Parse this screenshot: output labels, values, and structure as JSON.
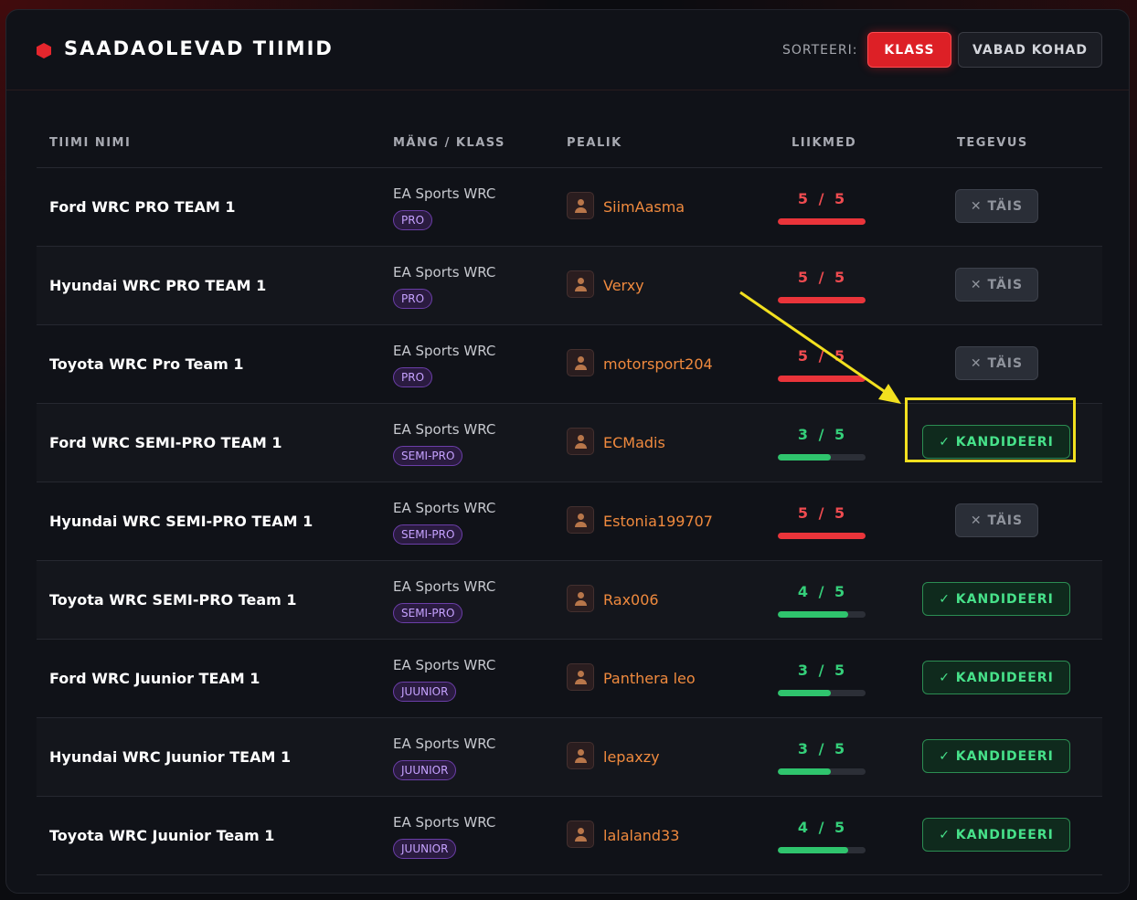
{
  "header": {
    "title": "SAADAOLEVAD TIIMID",
    "sort_label": "SORTEERI:",
    "sort_options": [
      "KLASS",
      "VABAD KOHAD"
    ]
  },
  "columns": [
    "TIIMI NIMI",
    "MÄNG / KLASS",
    "PEALIK",
    "LIIKMED",
    "TEGEVUS"
  ],
  "rows": [
    {
      "team": "Ford WRC PRO TEAM 1",
      "game": "EA Sports WRC",
      "class": "PRO",
      "leader": "SiimAasma",
      "members": "5 / 5",
      "fill": 1.0,
      "full": true,
      "action": "✕ TÄIS"
    },
    {
      "team": "Hyundai WRC PRO TEAM 1",
      "game": "EA Sports WRC",
      "class": "PRO",
      "leader": "Verxy",
      "members": "5 / 5",
      "fill": 1.0,
      "full": true,
      "action": "✕ TÄIS"
    },
    {
      "team": "Toyota WRC Pro Team 1",
      "game": "EA Sports WRC",
      "class": "PRO",
      "leader": "motorsport204",
      "members": "5 / 5",
      "fill": 1.0,
      "full": true,
      "action": "✕ TÄIS"
    },
    {
      "team": "Ford WRC SEMI-PRO TEAM 1",
      "game": "EA Sports WRC",
      "class": "SEMI-PRO",
      "leader": "ECMadis",
      "members": "3 / 5",
      "fill": 0.6,
      "full": false,
      "action": "✓ KANDIDEERI"
    },
    {
      "team": "Hyundai WRC SEMI-PRO TEAM 1",
      "game": "EA Sports WRC",
      "class": "SEMI-PRO",
      "leader": "Estonia199707",
      "members": "5 / 5",
      "fill": 1.0,
      "full": true,
      "action": "✕ TÄIS"
    },
    {
      "team": "Toyota WRC SEMI-PRO Team 1",
      "game": "EA Sports WRC",
      "class": "SEMI-PRO",
      "leader": "Rax006",
      "members": "4 / 5",
      "fill": 0.8,
      "full": false,
      "action": "✓ KANDIDEERI"
    },
    {
      "team": "Ford WRC Juunior TEAM 1",
      "game": "EA Sports WRC",
      "class": "JUUNIOR",
      "leader": "Panthera leo",
      "members": "3 / 5",
      "fill": 0.6,
      "full": false,
      "action": "✓ KANDIDEERI"
    },
    {
      "team": "Hyundai WRC Juunior TEAM 1",
      "game": "EA Sports WRC",
      "class": "JUUNIOR",
      "leader": "lepaxzy",
      "members": "3 / 5",
      "fill": 0.6,
      "full": false,
      "action": "✓ KANDIDEERI"
    },
    {
      "team": "Toyota WRC Juunior Team 1",
      "game": "EA Sports WRC",
      "class": "JUUNIOR",
      "leader": "lalaland33",
      "members": "4 / 5",
      "fill": 0.8,
      "full": false,
      "action": "✓ KANDIDEERI"
    }
  ],
  "annotation": {
    "color": "#f2e01f",
    "highlighted_row": 3
  },
  "colors": {
    "accent": "#dd2026",
    "full": "#ef4b50",
    "open": "#35d07a",
    "leader": "#f08a3e",
    "badge": "#c6a2ff"
  }
}
